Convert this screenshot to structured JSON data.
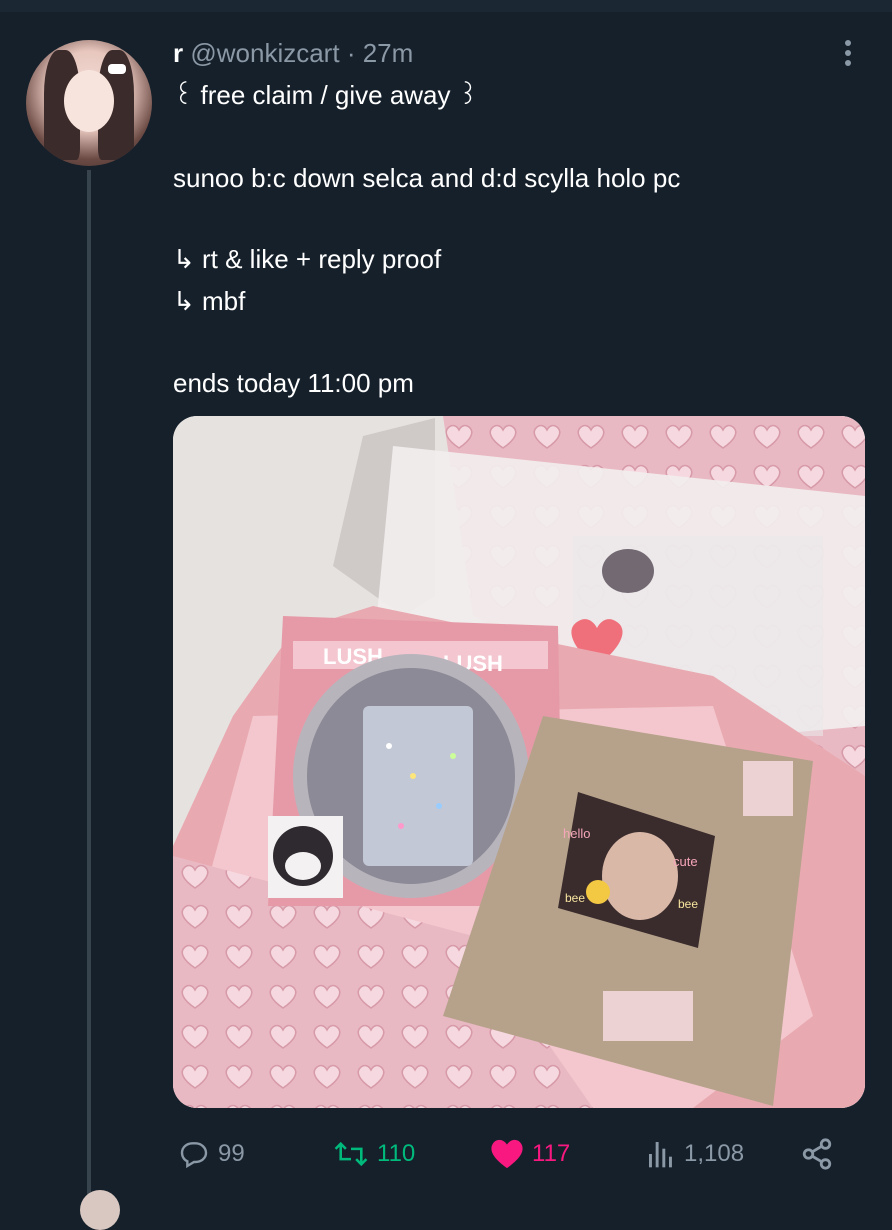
{
  "tweet": {
    "display_name": "r",
    "handle": "@wonkizcart",
    "separator": "·",
    "time": "27m",
    "lines": [
      "꒰ free claim / give away ꒱",
      "sunoo b:c down selca and d:d scylla holo pc",
      "↳ rt & like + reply proof",
      "↳ mbf",
      "ends today 11:00 pm"
    ]
  },
  "media_lettering": {
    "wrapper_left": "LUSH",
    "wrapper_right": "LUSH",
    "sticker_left": "hello",
    "sticker_right": "cute",
    "sticker_bottom_left": "bee",
    "sticker_bottom_right": "bee"
  },
  "actions": {
    "reply_count": "99",
    "retweet_count": "110",
    "like_count": "117",
    "views_count": "1,108"
  },
  "colors": {
    "background": "#15202b",
    "text": "#ffffff",
    "muted": "#8b98a5",
    "retweet": "#00ba7c",
    "like": "#f91880"
  },
  "icons": [
    "more-icon",
    "reply-icon",
    "retweet-icon",
    "like-icon",
    "views-icon",
    "share-icon"
  ]
}
